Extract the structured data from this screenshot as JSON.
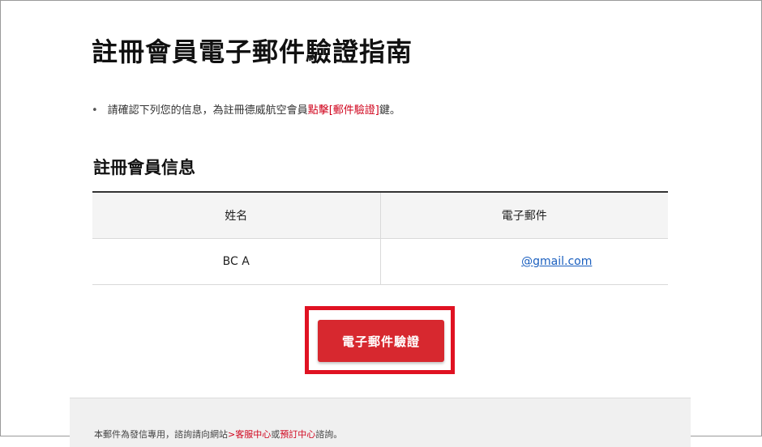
{
  "page": {
    "title": "註冊會員電子郵件驗證指南"
  },
  "notice": {
    "bullet": "•",
    "text_before": "請確認下列您的信息，為註冊德威航空會員",
    "highlight": "點擊[郵件驗證]",
    "text_after": "鍵。"
  },
  "section": {
    "title": "註冊會員信息"
  },
  "table": {
    "headers": [
      "姓名",
      "電子郵件"
    ],
    "rows": [
      {
        "name": "BC A",
        "email": "@gmail.com"
      }
    ]
  },
  "verify_button": {
    "label": "電子郵件驗證"
  },
  "footer": {
    "text_before": "本郵件為發信專用，諮詢請向網站",
    "link1": ">客服中心",
    "text_middle": "或",
    "link2": "預訂中心",
    "text_after": "諮詢。"
  },
  "colors": {
    "accent": "#d7282f",
    "highlight_frame": "#e01222",
    "link": "#1a5fbf"
  }
}
